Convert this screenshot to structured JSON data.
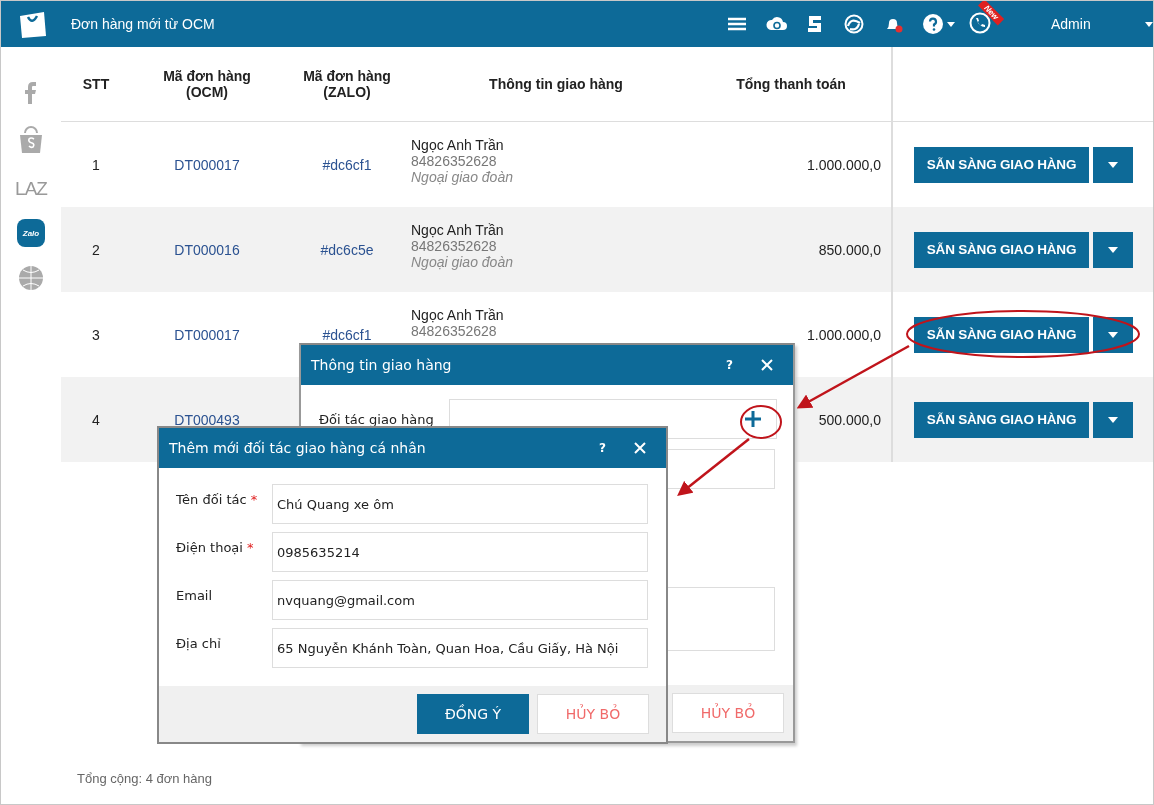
{
  "header": {
    "title": "Đơn hàng mới từ OCM",
    "new_badge": "New",
    "user": "Admin"
  },
  "sidebar": {
    "items": [
      {
        "kind": "facebook",
        "selected": false
      },
      {
        "kind": "shop",
        "selected": false
      },
      {
        "kind": "text",
        "label": "LAZ",
        "selected": false
      },
      {
        "kind": "zalo",
        "label": "Zalo",
        "selected": true
      },
      {
        "kind": "web",
        "selected": false
      }
    ]
  },
  "table": {
    "columns": [
      "STT",
      "Mã đơn hàng\n(OCM)",
      "Mã đơn hàng\n(ZALO)",
      "Thông tin giao hàng",
      "Tổng thanh toán"
    ],
    "rows": [
      {
        "stt": "1",
        "ocm": "DT000017",
        "zalo": "#dc6cf1",
        "name": "Ngọc Anh Trần",
        "phone": "84826352628",
        "address": "Ngoại giao đoàn",
        "total": "1.000.000,0",
        "action": "SẴN SÀNG GIAO HÀNG",
        "highlighted": false
      },
      {
        "stt": "2",
        "ocm": "DT000016",
        "zalo": "#dc6c5e",
        "name": "Ngọc Anh Trần",
        "phone": "84826352628",
        "address": "Ngoại giao đoàn",
        "total": "850.000,0",
        "action": "SẴN SÀNG GIAO HÀNG",
        "highlighted": false
      },
      {
        "stt": "3",
        "ocm": "DT000017",
        "zalo": "#dc6cf1",
        "name": "Ngọc Anh Trần",
        "phone": "84826352628",
        "total": "1.000.000,0",
        "action": "SẴN SÀNG GIAO HÀNG",
        "highlighted": true
      },
      {
        "stt": "4",
        "ocm": "DT000493",
        "total": "500.000,0",
        "action": "SẴN SÀNG GIAO HÀNG",
        "highlighted": false
      }
    ]
  },
  "footer": {
    "summary": "Tổng cộng: 4 đơn hàng"
  },
  "delivery_dialog": {
    "title": "Thông tin giao hàng",
    "help": "?",
    "partner_label": "Đối tác giao hàng",
    "cancel": "HỦY BỎ"
  },
  "partner_dialog": {
    "title": "Thêm mới đối tác giao hàng cá nhân",
    "help": "?",
    "fields": [
      {
        "label": "Tên đối tác",
        "required_mark": "*",
        "value": "Chú Quang xe ôm"
      },
      {
        "label": "Điện thoại",
        "required_mark": "*",
        "value": "0985635214"
      },
      {
        "label": "Email",
        "value": "nvquang@gmail.com"
      },
      {
        "label": "Địa chỉ",
        "value": "65 Nguyễn Khánh Toàn, Quan Hoa, Cầu Giấy, Hà Nội"
      }
    ],
    "ok": "ĐỒNG Ý",
    "cancel": "HỦY BỎ"
  }
}
